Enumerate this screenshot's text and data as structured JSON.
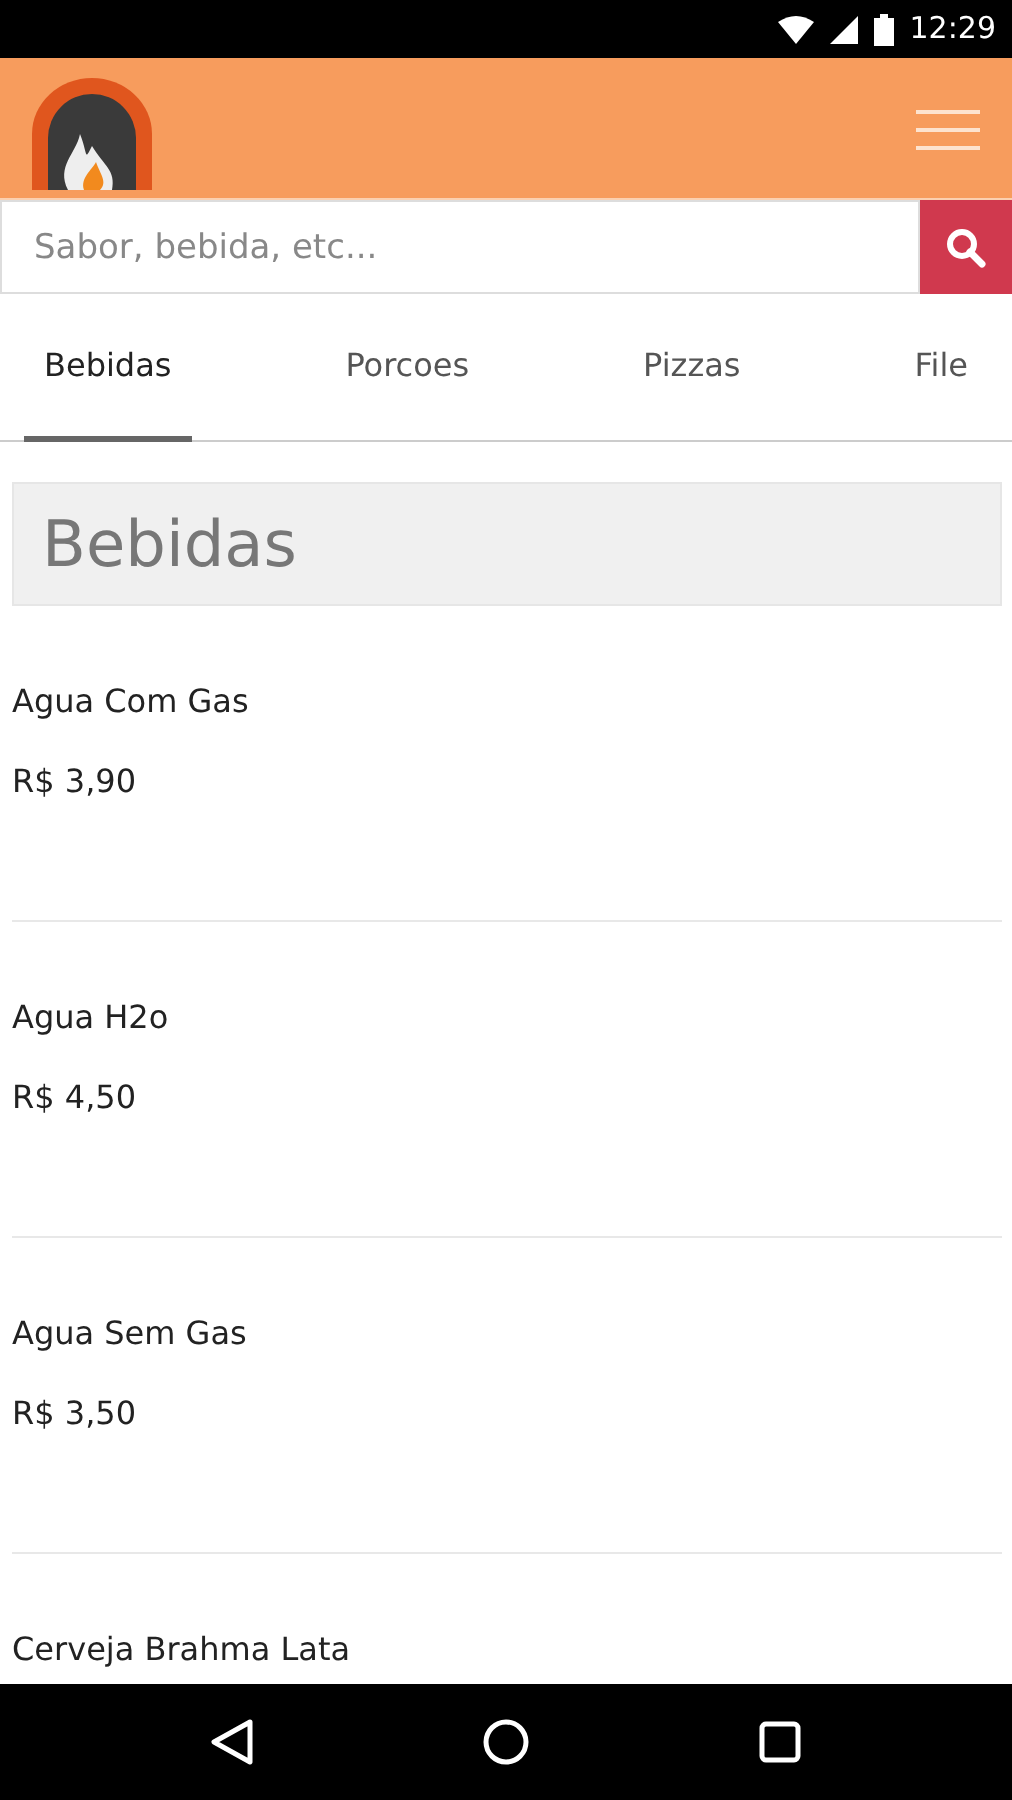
{
  "status_bar": {
    "time": "12:29"
  },
  "search": {
    "placeholder": "Sabor, bebida, etc..."
  },
  "tabs": [
    {
      "label": "Bebidas",
      "selected": true
    },
    {
      "label": "Porcoes",
      "selected": false
    },
    {
      "label": "Pizzas",
      "selected": false
    },
    {
      "label": "File",
      "selected": false
    }
  ],
  "section": {
    "title": "Bebidas"
  },
  "items": [
    {
      "name": "Agua Com Gas",
      "price": "R$ 3,90"
    },
    {
      "name": "Agua H2o",
      "price": "R$ 4,50"
    },
    {
      "name": "Agua Sem Gas",
      "price": "R$ 3,50"
    },
    {
      "name": "Cerveja Brahma Lata"
    }
  ]
}
